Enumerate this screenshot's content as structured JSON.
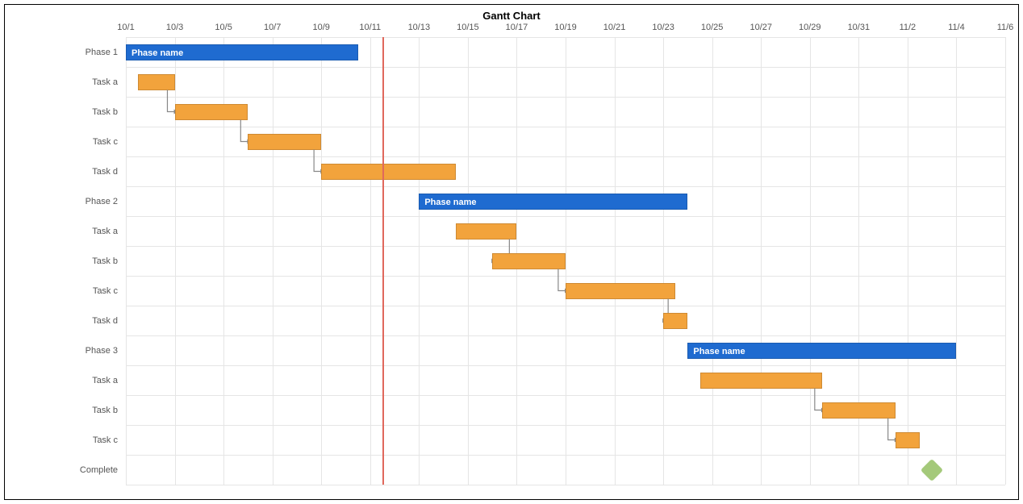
{
  "chart_data": {
    "type": "gantt",
    "title": "Gantt Chart",
    "x_start": "10/1",
    "x_end": "11/6",
    "total_days": 36,
    "date_ticks": [
      "10/1",
      "10/3",
      "10/5",
      "10/7",
      "10/9",
      "10/11",
      "10/13",
      "10/15",
      "10/17",
      "10/19",
      "10/21",
      "10/23",
      "10/25",
      "10/27",
      "10/29",
      "10/31",
      "11/2",
      "11/4",
      "11/6"
    ],
    "today_marker": 10.5,
    "rows": [
      {
        "label": "Phase 1",
        "type": "phase",
        "start": 0,
        "end": 9.5,
        "text": "Phase name"
      },
      {
        "label": "Task a",
        "type": "task",
        "start": 0.5,
        "end": 2,
        "arrow_to_next": true
      },
      {
        "label": "Task b",
        "type": "task",
        "start": 2,
        "end": 5,
        "arrow_to_next": true
      },
      {
        "label": "Task c",
        "type": "task",
        "start": 5,
        "end": 8,
        "arrow_to_next": true
      },
      {
        "label": "Task d",
        "type": "task",
        "start": 8,
        "end": 13.5
      },
      {
        "label": "Phase 2",
        "type": "phase",
        "start": 12,
        "end": 23,
        "text": "Phase name"
      },
      {
        "label": "Task a",
        "type": "task",
        "start": 13.5,
        "end": 16,
        "arrow_to_next": true
      },
      {
        "label": "Task b",
        "type": "task",
        "start": 15,
        "end": 18,
        "arrow_to_next": true
      },
      {
        "label": "Task c",
        "type": "task",
        "start": 18,
        "end": 22.5,
        "arrow_to_next": true
      },
      {
        "label": "Task d",
        "type": "task",
        "start": 22,
        "end": 23
      },
      {
        "label": "Phase 3",
        "type": "phase",
        "start": 23,
        "end": 34,
        "text": "Phase name"
      },
      {
        "label": "Task a",
        "type": "task",
        "start": 23.5,
        "end": 28.5,
        "arrow_to_next": true
      },
      {
        "label": "Task b",
        "type": "task",
        "start": 28.5,
        "end": 31.5,
        "arrow_to_next": true
      },
      {
        "label": "Task c",
        "type": "task",
        "start": 31.5,
        "end": 32.5
      },
      {
        "label": "Complete",
        "type": "milestone",
        "at": 33
      }
    ],
    "colors": {
      "phase": "#1f6bd0",
      "task": "#f2a33c",
      "milestone": "#a4c97a",
      "today": "#e0685c",
      "grid": "#e5e5e5"
    }
  }
}
